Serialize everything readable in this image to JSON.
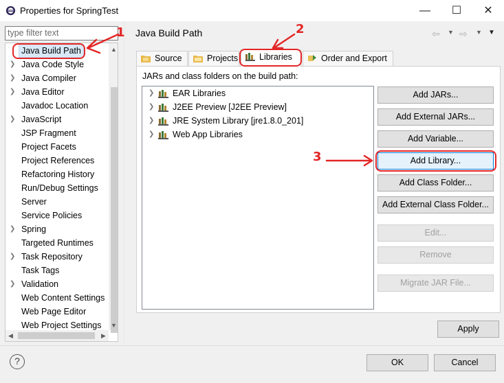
{
  "window": {
    "title": "Properties for SpringTest",
    "minimize_icon": "minimize-icon",
    "maximize_icon": "maximize-icon",
    "close_icon": "close-icon"
  },
  "filter": {
    "placeholder": "type filter text"
  },
  "tree": {
    "items": [
      {
        "label": "Java Build Path",
        "expandable": false,
        "selected": true
      },
      {
        "label": "Java Code Style",
        "expandable": true
      },
      {
        "label": "Java Compiler",
        "expandable": true
      },
      {
        "label": "Java Editor",
        "expandable": true
      },
      {
        "label": "Javadoc Location",
        "expandable": false
      },
      {
        "label": "JavaScript",
        "expandable": true
      },
      {
        "label": "JSP Fragment",
        "expandable": false
      },
      {
        "label": "Project Facets",
        "expandable": false
      },
      {
        "label": "Project References",
        "expandable": false
      },
      {
        "label": "Refactoring History",
        "expandable": false
      },
      {
        "label": "Run/Debug Settings",
        "expandable": false
      },
      {
        "label": "Server",
        "expandable": false
      },
      {
        "label": "Service Policies",
        "expandable": false
      },
      {
        "label": "Spring",
        "expandable": true
      },
      {
        "label": "Targeted Runtimes",
        "expandable": false
      },
      {
        "label": "Task Repository",
        "expandable": true
      },
      {
        "label": "Task Tags",
        "expandable": false
      },
      {
        "label": "Validation",
        "expandable": true
      },
      {
        "label": "Web Content Settings",
        "expandable": false
      },
      {
        "label": "Web Page Editor",
        "expandable": false
      },
      {
        "label": "Web Project Settings",
        "expandable": false
      }
    ]
  },
  "page": {
    "title": "Java Build Path"
  },
  "tabs": [
    {
      "label": "Source",
      "icon": "source-folder-icon"
    },
    {
      "label": "Projects",
      "icon": "projects-folder-icon"
    },
    {
      "label": "Libraries",
      "icon": "library-icon",
      "active": true
    },
    {
      "label": "Order and Export",
      "icon": "order-export-icon"
    }
  ],
  "libraries": {
    "label": "JARs and class folders on the build path:",
    "items": [
      {
        "label": "EAR Libraries"
      },
      {
        "label": "J2EE Preview [J2EE Preview]"
      },
      {
        "label": "JRE System Library [jre1.8.0_201]"
      },
      {
        "label": "Web App Libraries"
      }
    ]
  },
  "buttons": {
    "add_jars": "Add JARs...",
    "add_external_jars": "Add External JARs...",
    "add_variable": "Add Variable...",
    "add_library": "Add Library...",
    "add_class_folder": "Add Class Folder...",
    "add_external_class_folder": "Add External Class Folder...",
    "edit": "Edit...",
    "remove": "Remove",
    "migrate": "Migrate JAR File...",
    "apply": "Apply",
    "ok": "OK",
    "cancel": "Cancel",
    "help": "?"
  },
  "annotations": {
    "n1": "1",
    "n2": "2",
    "n3": "3",
    "color": "#e32626"
  }
}
